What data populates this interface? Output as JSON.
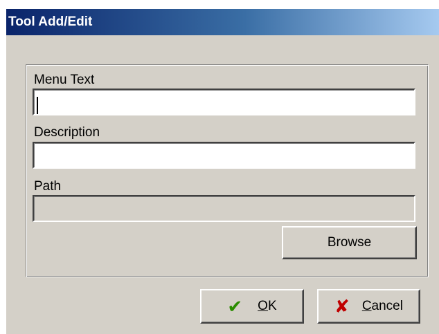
{
  "window": {
    "title": "Tool Add/Edit"
  },
  "form": {
    "menu_text": {
      "label": "Menu Text",
      "value": ""
    },
    "description": {
      "label": "Description",
      "value": ""
    },
    "path": {
      "label": "Path",
      "value": ""
    },
    "browse_label": "Browse"
  },
  "buttons": {
    "ok": {
      "mnemonic": "O",
      "rest": "K",
      "icon": "checkmark-icon"
    },
    "cancel": {
      "mnemonic": "C",
      "rest": "ancel",
      "icon": "x-icon"
    }
  },
  "colors": {
    "titlebar_start": "#0a246a",
    "titlebar_end": "#a6caf0",
    "dialog_face": "#d4d0c8",
    "ok_check": "#2a8c00",
    "cancel_cross": "#c00000"
  }
}
